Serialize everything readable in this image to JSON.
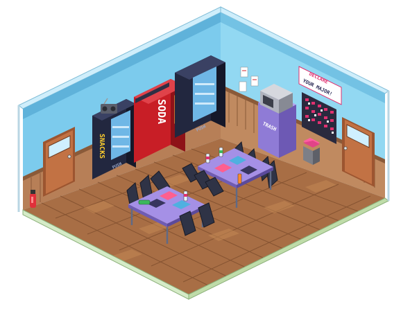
{
  "scene": {
    "type": "isometric pixel-art room",
    "theme": "student break room"
  },
  "snack_machine": {
    "label": "SNACKS",
    "push_label": "PUSH"
  },
  "soda_machine": {
    "label": "SODA"
  },
  "drink_machine": {
    "push_label": "PUSH"
  },
  "trash_cabinet": {
    "label": "TRASH"
  },
  "banner": {
    "line1": "DECLARE",
    "line2": "YOUR MAJOR!"
  },
  "colors": {
    "wall": "#8fd3ef",
    "wall_dark": "#6cb9dc",
    "wainscot": "#b8825a",
    "floor": "#a87148",
    "floor_light": "#c58a58",
    "soda_red": "#d01f2a",
    "table_purple": "#9b86dd",
    "door": "#b66a3e"
  },
  "icons": [
    "radio-icon",
    "microwave-icon",
    "fire-extinguisher-icon",
    "trash-bin-icon",
    "bottle-icon"
  ]
}
